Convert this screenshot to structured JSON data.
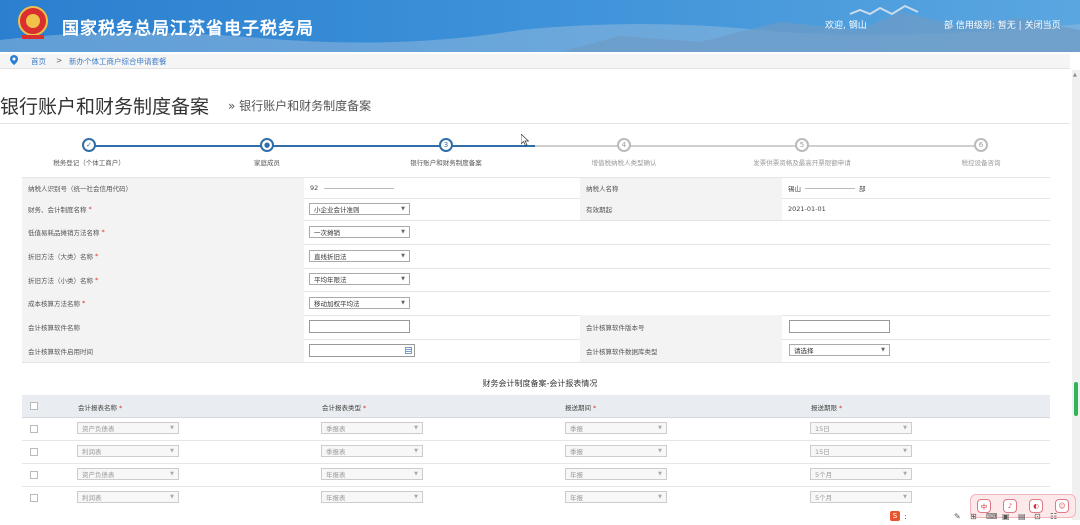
{
  "header": {
    "site_title": "国家税务总局江苏省电子税务局",
    "welcome": "欢迎, 钢山",
    "credit_prefix": "部",
    "credit_label": "信用级别: 暂无",
    "separator": "|",
    "close_label": "关闭当页",
    "accent_color": "#3b90d8"
  },
  "breadcrumb": {
    "home": "首页",
    "sep": ">",
    "current": "新办个体工商户综合申请套餐"
  },
  "page": {
    "title": "银行账户和财务制度备案",
    "subtitle": "» 银行账户和财务制度备案"
  },
  "steps": [
    {
      "num": "✓",
      "label": "税务登记（个体工商户）",
      "state": "done"
    },
    {
      "num": "●",
      "label": "家庭成员",
      "state": "done"
    },
    {
      "num": "3",
      "label": "银行账户和财务制度备案",
      "state": "current"
    },
    {
      "num": "4",
      "label": "增值税纳税人类型确认",
      "state": "todo"
    },
    {
      "num": "5",
      "label": "发票供票资格及最高开票限额申请",
      "state": "todo"
    },
    {
      "num": "6",
      "label": "税控设备咨询",
      "state": "todo"
    }
  ],
  "form": {
    "taxpayer_id_label": "纳税人识别号（统一社会信用代码）",
    "taxpayer_id_value": "92",
    "taxpayer_name_label": "纳税人名称",
    "taxpayer_name_value1": "锡山",
    "taxpayer_name_value2": "部",
    "accounting_system_label": "财务、会计制度名称",
    "accounting_system_value": "小企业会计准则",
    "effective_date_label": "有效期起",
    "effective_date_value": "2021-01-01",
    "low_value_label": "低值易耗品摊销方法名称",
    "low_value_value": "一次摊销",
    "dep_large_label": "折旧方法（大类）名称",
    "dep_large_value": "直线折旧法",
    "dep_small_label": "折旧方法（小类）名称",
    "dep_small_value": "平均年限法",
    "cost_method_label": "成本核算方法名称",
    "cost_method_value": "移动加权平均法",
    "software_name_label": "会计核算软件名称",
    "software_version_label": "会计核算软件版本号",
    "software_date_label": "会计核算软件启用时间",
    "software_db_label": "会计核算软件数据库类型",
    "software_db_value": "请选择",
    "required_mark": "*"
  },
  "report": {
    "section_title": "财务会计制度备案-会计报表情况",
    "headers": [
      "会计报表名称",
      "会计报表类型",
      "报送期间",
      "报送期限"
    ],
    "rows": [
      [
        "资产负债表",
        "季报表",
        "季报",
        "15日"
      ],
      [
        "利润表",
        "季报表",
        "季报",
        "15日"
      ],
      [
        "资产负债表",
        "年报表",
        "年报",
        "5个月"
      ],
      [
        "利润表",
        "年报表",
        "年报",
        "5个月"
      ]
    ]
  },
  "chat_widget": {
    "items": [
      "中",
      "♪",
      "◐",
      "☺"
    ]
  },
  "toolbar": {
    "ime": "S",
    "colon": ":",
    "items": [
      "✎",
      "⊞",
      "⌨",
      "▣",
      "▤",
      "⊡",
      "☷"
    ]
  }
}
